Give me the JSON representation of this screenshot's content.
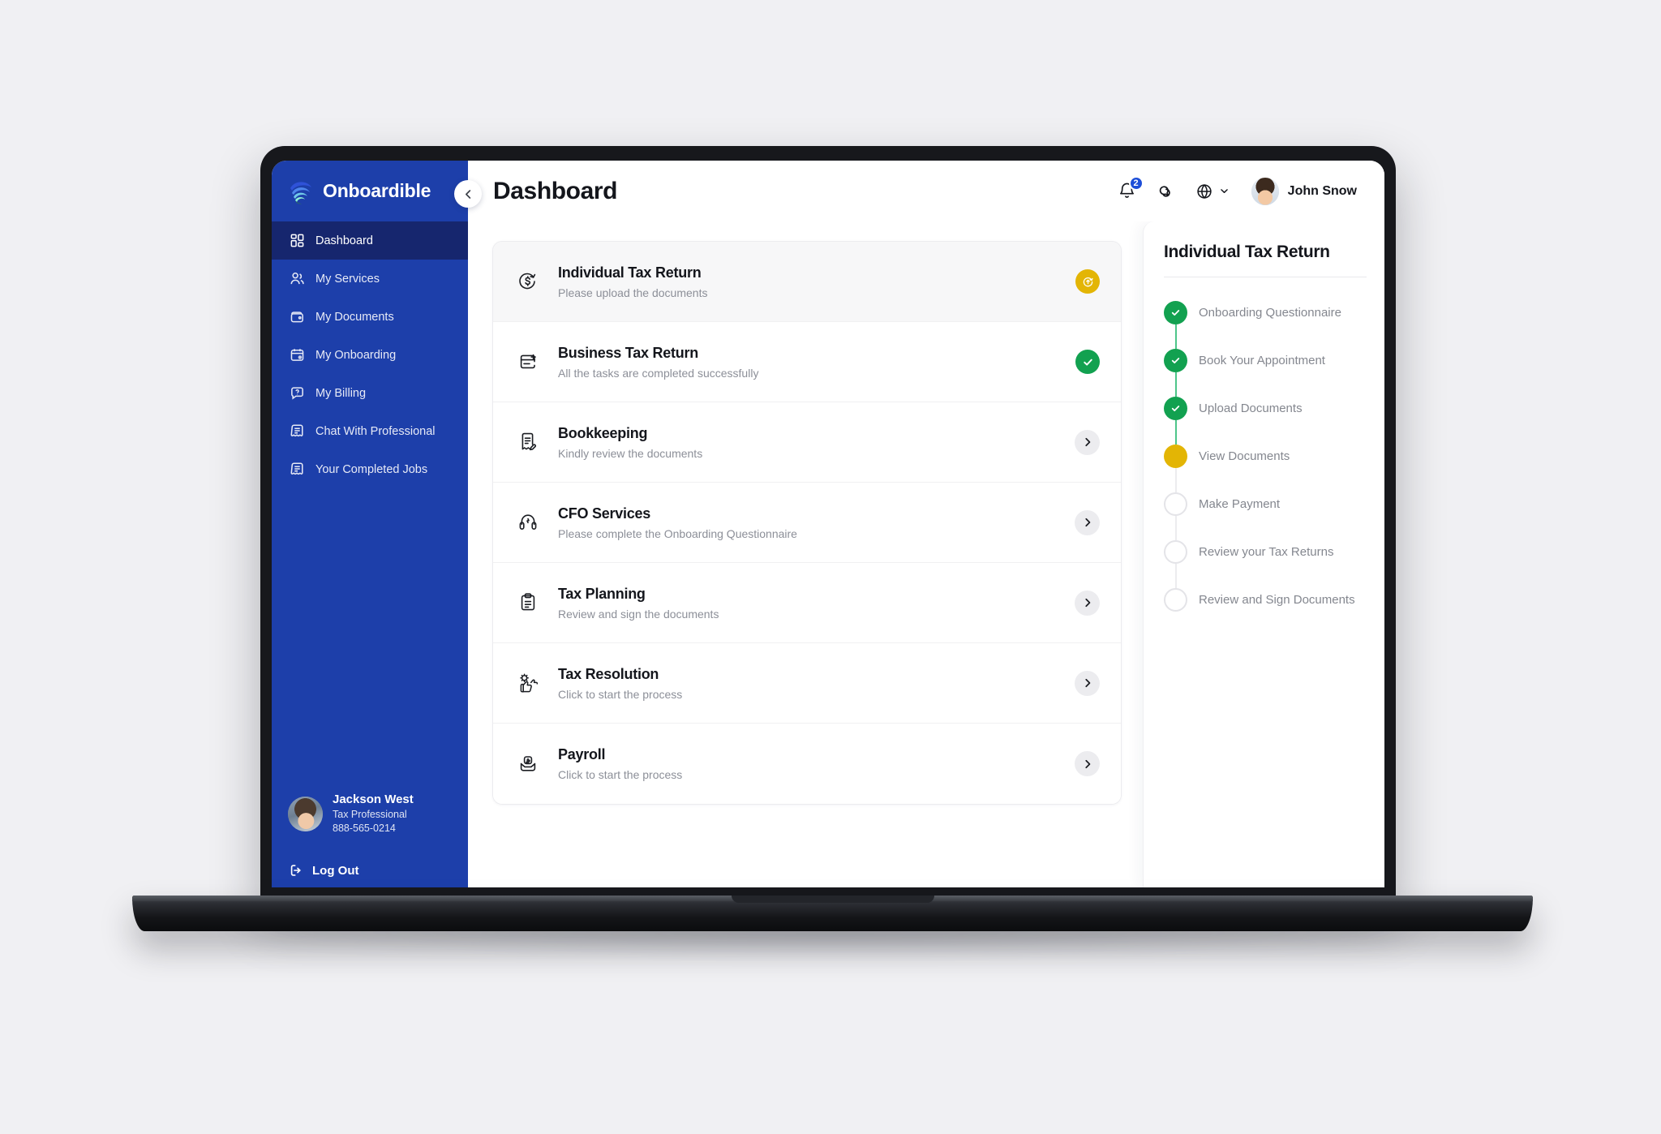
{
  "sidebar": {
    "brand": {
      "name": "Onboardible",
      "logo_icon": "onboardible-logo-icon"
    },
    "items": [
      {
        "label": "Dashboard",
        "icon": "grid-icon",
        "active": true
      },
      {
        "label": "My Services",
        "icon": "users-icon",
        "active": false
      },
      {
        "label": "My Documents",
        "icon": "wallet-icon",
        "active": false
      },
      {
        "label": "My Onboarding",
        "icon": "calendar-icon",
        "active": false
      },
      {
        "label": "My Billing",
        "icon": "help-chat-icon",
        "active": false
      },
      {
        "label": "Chat With Professional",
        "icon": "message-lines-icon",
        "active": false
      },
      {
        "label": "Your Completed Jobs",
        "icon": "message-lines-icon",
        "active": false
      }
    ],
    "user": {
      "name": "Jackson West",
      "role": "Tax Professional",
      "phone": "888-565-0214",
      "avatar_icon": "avatar"
    },
    "logout": {
      "label": "Log Out",
      "icon": "logout-icon"
    }
  },
  "topbar": {
    "collapse_icon": "chevron-left-icon",
    "title": "Dashboard",
    "notifications": {
      "icon": "bell-icon",
      "count": "2"
    },
    "messages": {
      "icon": "chat-bubbles-icon"
    },
    "language": {
      "icon": "globe-icon",
      "chevron": "chevron-down-icon"
    },
    "user": {
      "name": "John Snow",
      "avatar_icon": "avatar"
    }
  },
  "main": {
    "cards": [
      {
        "title": "Individual Tax Return",
        "subtitle": "Please upload the documents",
        "icon": "dollar-refresh-icon",
        "status": "pending",
        "status_icon": "upload-badge-icon",
        "highlight": true
      },
      {
        "title": "Business Tax Return",
        "subtitle": "All the tasks are completed successfully",
        "icon": "document-plus-icon",
        "status": "complete",
        "status_icon": "check-icon",
        "highlight": false
      },
      {
        "title": "Bookkeeping",
        "subtitle": "Kindly review the documents",
        "icon": "document-edit-icon",
        "status": "chevron",
        "status_icon": "chevron-right-icon",
        "highlight": false
      },
      {
        "title": "CFO Services",
        "subtitle": "Please complete the Onboarding Questionnaire",
        "icon": "headset-icon",
        "status": "chevron",
        "status_icon": "chevron-right-icon",
        "highlight": false
      },
      {
        "title": "Tax Planning",
        "subtitle": "Review and sign the documents",
        "icon": "clipboard-icon",
        "status": "chevron",
        "status_icon": "chevron-right-icon",
        "highlight": false
      },
      {
        "title": "Tax Resolution",
        "subtitle": "Click to start the process",
        "icon": "gear-thumbs-icon",
        "status": "chevron",
        "status_icon": "chevron-right-icon",
        "highlight": false
      },
      {
        "title": "Payroll",
        "subtitle": "Click to start the process",
        "icon": "money-inbox-icon",
        "status": "chevron",
        "status_icon": "chevron-right-icon",
        "highlight": false
      }
    ]
  },
  "right_panel": {
    "title": "Individual Tax Return",
    "steps": [
      {
        "label": "Onboarding Questionnaire",
        "state": "done"
      },
      {
        "label": "Book Your Appointment",
        "state": "done"
      },
      {
        "label": "Upload Documents",
        "state": "done"
      },
      {
        "label": "View Documents",
        "state": "current"
      },
      {
        "label": "Make Payment",
        "state": "todo"
      },
      {
        "label": "Review your Tax Returns",
        "state": "todo"
      },
      {
        "label": "Review and Sign Documents",
        "state": "todo"
      }
    ]
  },
  "colors": {
    "sidebar_bg": "#1d3faa",
    "sidebar_active": "#16266e",
    "accent_blue": "#1d4ed8",
    "success_green": "#12a150",
    "pending_yellow": "#e3b505",
    "page_bg": "#f0f0f3"
  }
}
